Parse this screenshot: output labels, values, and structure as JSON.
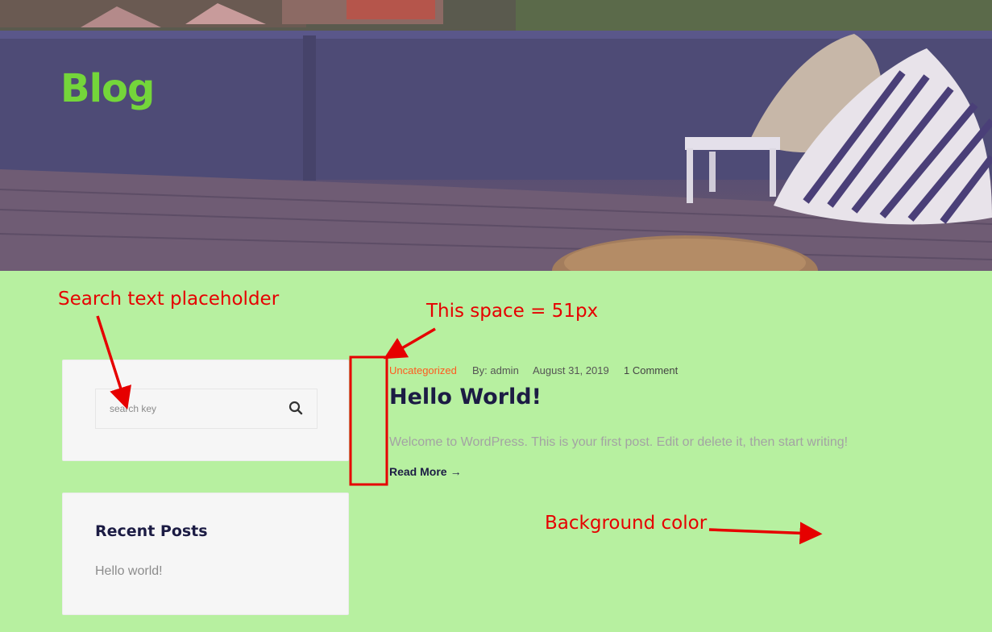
{
  "hero": {
    "title": "Blog"
  },
  "search": {
    "placeholder": "search key",
    "icon": "search-icon"
  },
  "recent_posts": {
    "title": "Recent Posts",
    "items": [
      {
        "label": "Hello world!"
      }
    ]
  },
  "post": {
    "category": "Uncategorized",
    "author": "By: admin",
    "date": "August 31, 2019",
    "comments": "1 Comment",
    "title": "Hello World!",
    "excerpt": "Welcome to WordPress. This is your first post. Edit or delete it, then start writing!",
    "read_more": "Read More",
    "read_more_arrow": "→"
  },
  "annotations": {
    "search_placeholder": "Search text placeholder",
    "spacing": "This space = 51px",
    "background": "Background color",
    "color": "#e60000"
  },
  "colors": {
    "page_background": "#b7f0a0",
    "hero_title": "#74d63a",
    "category": "#ff5a1f",
    "heading": "#1c1c44"
  }
}
